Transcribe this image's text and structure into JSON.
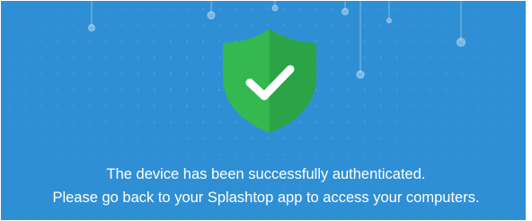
{
  "auth_page": {
    "message_line_1": "The device has been successfully authenticated.",
    "message_line_2": "Please go back to your Splashtop app to access your computers.",
    "icon": "shield-check-icon",
    "colors": {
      "background": "#2f8fd5",
      "shield": "#34b84f",
      "shield_shadow": "#2aa446",
      "checkmark": "#ffffff",
      "text": "#ffffff"
    }
  }
}
